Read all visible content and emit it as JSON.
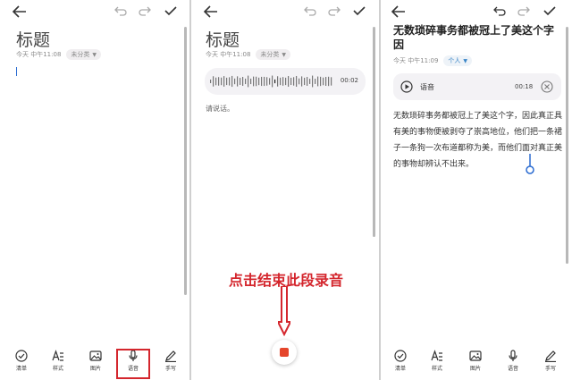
{
  "panel1": {
    "title": "标题",
    "meta_time": "今天 中午11:08",
    "meta_tag": "未分类",
    "tools": [
      {
        "label": "清单",
        "icon": "checklist-icon"
      },
      {
        "label": "样式",
        "icon": "text-style-icon"
      },
      {
        "label": "图片",
        "icon": "image-icon"
      },
      {
        "label": "语音",
        "icon": "microphone-icon"
      },
      {
        "label": "手写",
        "icon": "pen-icon"
      }
    ]
  },
  "panel2": {
    "title": "标题",
    "meta_time": "今天 中午11:08",
    "meta_tag": "未分类",
    "wave_time": "00:02",
    "hint": "请说话。",
    "annotation": "点击结束此段录音"
  },
  "panel3": {
    "title": "无数琐碎事务都被冠上了美这个字因",
    "meta_time": "今天 中午11:09",
    "meta_tag": "个人",
    "audio_label": "语音",
    "audio_time": "00:18",
    "body": "无数琐碎事务都被冠上了美这个字，因此真正具有美的事物便被剥夺了崇高地位，他们把一条裙子一条狗一次布道都称为美，而他们面对真正美的事物却辨认不出来。",
    "tools": [
      {
        "label": "清单",
        "icon": "checklist-icon"
      },
      {
        "label": "样式",
        "icon": "text-style-icon"
      },
      {
        "label": "图片",
        "icon": "image-icon"
      },
      {
        "label": "语音",
        "icon": "microphone-icon"
      },
      {
        "label": "手写",
        "icon": "pen-icon"
      }
    ]
  },
  "colors": {
    "annotation_red": "#d4262d",
    "stop_orange": "#e5452b",
    "tag_blue": "#3a86c8"
  }
}
